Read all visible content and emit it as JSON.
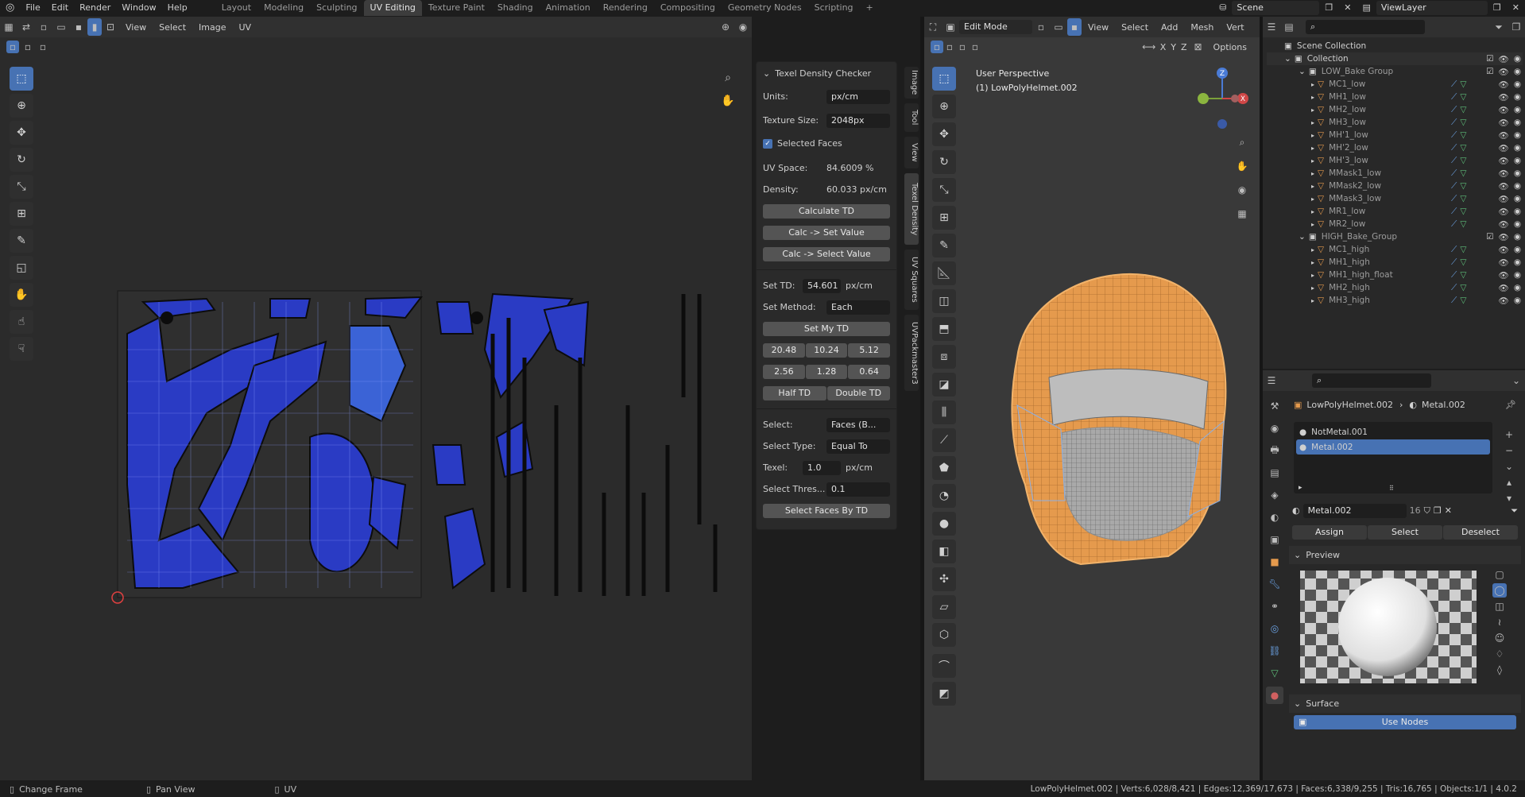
{
  "app": {
    "menu": [
      "File",
      "Edit",
      "Render",
      "Window",
      "Help"
    ],
    "workspaces": [
      "Layout",
      "Modeling",
      "Sculpting",
      "UV Editing",
      "Texture Paint",
      "Shading",
      "Animation",
      "Rendering",
      "Compositing",
      "Geometry Nodes",
      "Scripting"
    ],
    "active_workspace": "UV Editing",
    "add_tab": "+",
    "scene": "Scene",
    "view_layer": "ViewLayer"
  },
  "uv_editor": {
    "menus": [
      "View",
      "Select",
      "Image",
      "UV"
    ]
  },
  "texel_density": {
    "title": "Texel Density Checker",
    "units_label": "Units:",
    "units_value": "px/cm",
    "texture_size_label": "Texture Size:",
    "texture_size_value": "2048px",
    "selected_faces_label": "Selected Faces",
    "uv_space_label": "UV Space:",
    "uv_space_value": "84.6009 %",
    "density_label": "Density:",
    "density_value": "60.033 px/cm",
    "calculate_td": "Calculate TD",
    "calc_set_value": "Calc -> Set Value",
    "calc_select_value": "Calc -> Select Value",
    "set_td_label": "Set TD:",
    "set_td_value": "54.601",
    "set_td_unit": "px/cm",
    "set_method_label": "Set Method:",
    "set_method_value": "Each",
    "set_my_td": "Set My TD",
    "presets_row1": [
      "20.48",
      "10.24",
      "5.12"
    ],
    "presets_row2": [
      "2.56",
      "1.28",
      "0.64"
    ],
    "half_td": "Half TD",
    "double_td": "Double TD",
    "select_label": "Select:",
    "select_value": "Faces (B...",
    "select_type_label": "Select Type:",
    "select_type_value": "Equal To",
    "texel_label": "Texel:",
    "texel_value": "1.0",
    "texel_unit": "px/cm",
    "select_thres_label": "Select Thres...",
    "select_thres_value": "0.1",
    "select_faces_by_td": "Select Faces By TD"
  },
  "sidebar_tabs": [
    "Image",
    "Tool",
    "View",
    "Texel Density",
    "UV Squares",
    "UVPackmaster3"
  ],
  "viewport": {
    "mode": "Edit Mode",
    "menus": [
      "View",
      "Select",
      "Add",
      "Mesh",
      "Vert"
    ],
    "axes": [
      "X",
      "Y",
      "Z"
    ],
    "options": "Options",
    "perspective": "User Perspective",
    "object": "(1) LowPolyHelmet.002"
  },
  "outliner": {
    "root": "Scene Collection",
    "collection": "Collection",
    "groups": [
      {
        "name": "LOW_Bake Group",
        "items": [
          "MC1_low",
          "MH1_low",
          "MH2_low",
          "MH3_low",
          "MH'1_low",
          "MH'2_low",
          "MH'3_low",
          "MMask1_low",
          "MMask2_low",
          "MMask3_low",
          "MR1_low",
          "MR2_low"
        ]
      },
      {
        "name": "HIGH_Bake_Group",
        "items": [
          "MC1_high",
          "MH1_high",
          "MH1_high_float",
          "MH2_high",
          "MH3_high"
        ]
      }
    ]
  },
  "properties": {
    "breadcrumb_object": "LowPolyHelmet.002",
    "breadcrumb_material": "Metal.002",
    "slots": [
      "NotMetal.001",
      "Metal.002"
    ],
    "selected_slot": "Metal.002",
    "material_name": "Metal.002",
    "user_count": "16",
    "assign": "Assign",
    "select": "Select",
    "deselect": "Deselect",
    "preview_label": "Preview",
    "surface_label": "Surface",
    "use_nodes": "Use Nodes"
  },
  "status_bar": {
    "change_frame": "Change Frame",
    "pan_view": "Pan View",
    "uv": "UV",
    "stats": "LowPolyHelmet.002 | Verts:6,028/8,421 | Edges:12,369/17,673 | Faces:6,338/9,255 | Tris:16,765 | Objects:1/1 | 4.0.2"
  },
  "colors": {
    "accent": "#4772b3",
    "uv_island": "#2a3bc4",
    "mesh_orange": "#e59a4d",
    "background": "#1d1d1d"
  }
}
